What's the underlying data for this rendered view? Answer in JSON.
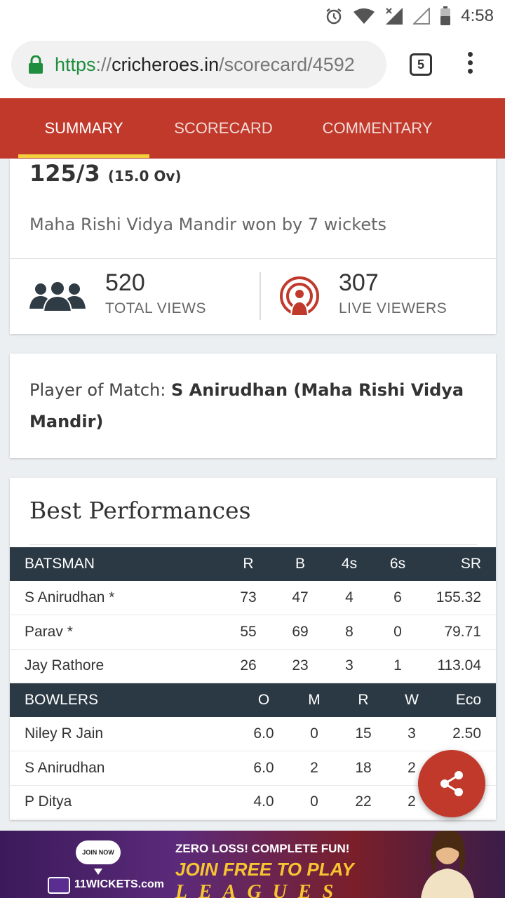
{
  "status_bar": {
    "time": "4:58"
  },
  "browser": {
    "url_scheme": "https",
    "url_sep": "://",
    "url_host": "cricheroes.in",
    "url_path": "/scorecard/4592",
    "tab_count": "5"
  },
  "tabs": [
    {
      "label": "SUMMARY",
      "active": true
    },
    {
      "label": "SCORECARD",
      "active": false
    },
    {
      "label": "COMMENTARY",
      "active": false
    }
  ],
  "summary": {
    "score": "125/3",
    "overs": "(15.0 Ov)",
    "result": "Maha Rishi Vidya Mandir won by 7 wickets"
  },
  "views": {
    "total_count": "520",
    "total_label": "TOTAL VIEWS",
    "live_count": "307",
    "live_label": "LIVE VIEWERS"
  },
  "player_of_match": {
    "label": "Player of Match: ",
    "name": "S Anirudhan (Maha Rishi Vidya Mandir)"
  },
  "best_performances": {
    "title": "Best Performances",
    "batting_headers": [
      "BATSMAN",
      "R",
      "B",
      "4s",
      "6s",
      "SR"
    ],
    "batting_rows": [
      [
        "S Anirudhan *",
        "73",
        "47",
        "4",
        "6",
        "155.32"
      ],
      [
        "Parav *",
        "55",
        "69",
        "8",
        "0",
        "79.71"
      ],
      [
        "Jay Rathore",
        "26",
        "23",
        "3",
        "1",
        "113.04"
      ]
    ],
    "bowling_headers": [
      "BOWLERS",
      "O",
      "M",
      "R",
      "W",
      "Eco"
    ],
    "bowling_rows": [
      [
        "Niley R Jain",
        "6.0",
        "0",
        "15",
        "3",
        "2.50"
      ],
      [
        "S Anirudhan",
        "6.0",
        "2",
        "18",
        "2",
        ""
      ],
      [
        "P Ditya",
        "4.0",
        "0",
        "22",
        "2",
        ""
      ]
    ]
  },
  "ad": {
    "join_button": "JOIN NOW",
    "brand": "11WICKETS.com",
    "headline": "ZERO LOSS! COMPLETE FUN!",
    "subline": "JOIN FREE TO PLAY",
    "tagline": "LEAGUES"
  },
  "colors": {
    "tab_bar": "#c0392b",
    "tab_indicator": "#f4d03f",
    "table_header": "#2b3944",
    "secure_green": "#1e8e3e"
  },
  "icons": {
    "alarm": "alarm-icon",
    "wifi": "wifi-icon",
    "signal": "signal-icon",
    "battery": "battery-icon",
    "lock": "lock-icon",
    "users": "users-icon",
    "live": "live-broadcast-icon",
    "share": "share-icon"
  }
}
